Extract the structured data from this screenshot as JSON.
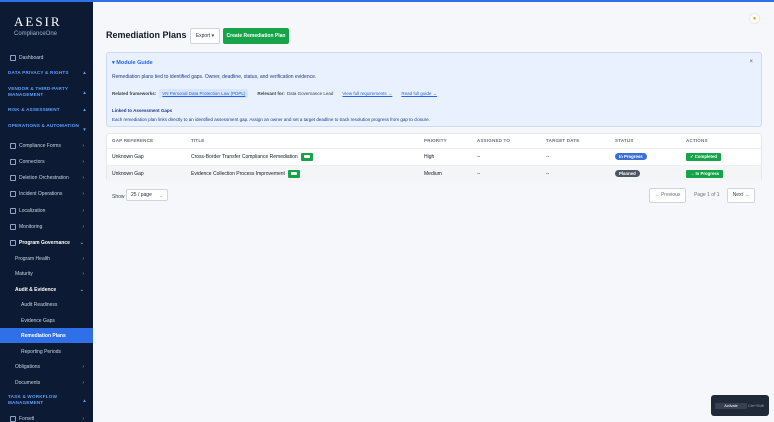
{
  "brand": {
    "line1": "AESIR",
    "line2": "ComplianceOne"
  },
  "sidebar": {
    "dashboard": "Dashboard",
    "sections": {
      "privacy": "DATA PRIVACY & RIGHTS",
      "vendor": "VENDOR & THIRD-PARTY MANAGEMENT",
      "risk": "RISK & ASSESSMENT",
      "ops": "OPERATIONS & AUTOMATION",
      "task": "TASK & WORKFLOW MANAGEMENT"
    },
    "items": {
      "forms": "Compliance Forms",
      "connectors": "Connectors",
      "deletion": "Deletion Orchestration",
      "incident": "Incident Operations",
      "localization": "Localization",
      "monitoring": "Monitoring",
      "program": "Program Governance",
      "health": "Program Health",
      "maturity": "Maturity",
      "audit": "Audit & Evidence",
      "readiness": "Audit Readiness",
      "evidence": "Evidence Gaps",
      "remediation": "Remediation Plans",
      "reporting": "Reporting Periods",
      "obligations": "Obligations",
      "documents": "Documents",
      "forsetl": "Forsetl"
    }
  },
  "header": {
    "title": "Remediation Plans",
    "export": "Export ▾",
    "create": "Create Remediation Plan"
  },
  "guide": {
    "title": "▾  Module Guide",
    "close": "×",
    "description": "Remediation plans tied to identified gaps. Owner, deadline, status, and verification evidence.",
    "frameworks_label": "Related frameworks:",
    "framework": "VN Personal Data Protection Law (PDPL)",
    "relevant_label": "Relevant for:",
    "relevant": "Data Governance Lead",
    "view_link": "View full requirements →",
    "read_link": "Read full guide →",
    "linked_title": "Linked to Assessment Gaps",
    "linked_desc": "Each remediation plan links directly to an identified assessment gap. Assign an owner and set a target deadline to track resolution progress from gap to closure."
  },
  "table": {
    "headers": [
      "GAP REFERENCE",
      "TITLE",
      "PRIORITY",
      "ASSIGNED TO",
      "TARGET DATE",
      "STATUS",
      "ACTIONS"
    ],
    "rows": [
      {
        "gap": "Unknown Gap",
        "title": "Cross-Border Transfer Compliance Remediation",
        "priority": "High",
        "assigned": "--",
        "target": "--",
        "status": "In Progress",
        "status_color": "#3b6fd8",
        "action": "✓ Completed"
      },
      {
        "gap": "Unknown Gap",
        "title": "Evidence Collection Process Improvement",
        "priority": "Medium",
        "assigned": "--",
        "target": "--",
        "status": "Planned",
        "status_color": "#4b5563",
        "action": "→ In Progress"
      }
    ]
  },
  "pagination": {
    "show": "Show",
    "per_page": "25 / page",
    "prev": "← Previous",
    "info": "Page 1 of 1",
    "next": "Next →"
  },
  "toast": {
    "activate": "Activate",
    "shortcut": "Ctrl+Shift"
  }
}
